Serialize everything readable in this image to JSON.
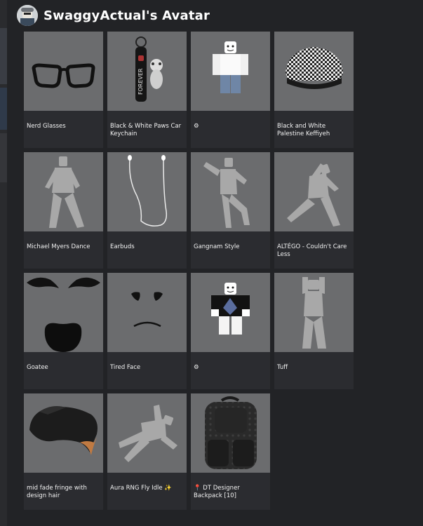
{
  "header": {
    "title": "SwaggyActual's Avatar"
  },
  "items": [
    {
      "name": "Nerd Glasses",
      "icon": "glasses-icon"
    },
    {
      "name": "Black & White Paws Car Keychain",
      "icon": "keychain-icon"
    },
    {
      "name": "⚙",
      "icon": "shirt-character-icon"
    },
    {
      "name": "Black and White Palestine Keffiyeh",
      "icon": "keffiyeh-icon"
    },
    {
      "name": "Michael Myers Dance",
      "icon": "dance-silhouette-icon"
    },
    {
      "name": "Earbuds",
      "icon": "earbuds-icon"
    },
    {
      "name": "Gangnam Style",
      "icon": "dance-silhouette-icon"
    },
    {
      "name": "ALTÉGO - Couldn't Care Less",
      "icon": "dance-silhouette-icon"
    },
    {
      "name": "Goatee",
      "icon": "goatee-icon"
    },
    {
      "name": "Tired Face",
      "icon": "face-icon"
    },
    {
      "name": "⚙",
      "icon": "shirt-character-icon"
    },
    {
      "name": "Tuff",
      "icon": "pose-silhouette-icon"
    },
    {
      "name": "mid fade fringe with design  hair",
      "icon": "hair-icon"
    },
    {
      "name": "Aura RNG Fly Idle ✨",
      "icon": "fly-silhouette-icon"
    },
    {
      "name": "📍 DT Designer Backpack [10]",
      "icon": "backpack-icon"
    }
  ],
  "colors": {
    "background": "#222326",
    "card": "#2b2c30",
    "thumb": "#6b6c6e",
    "text": "#f2f2f2"
  }
}
